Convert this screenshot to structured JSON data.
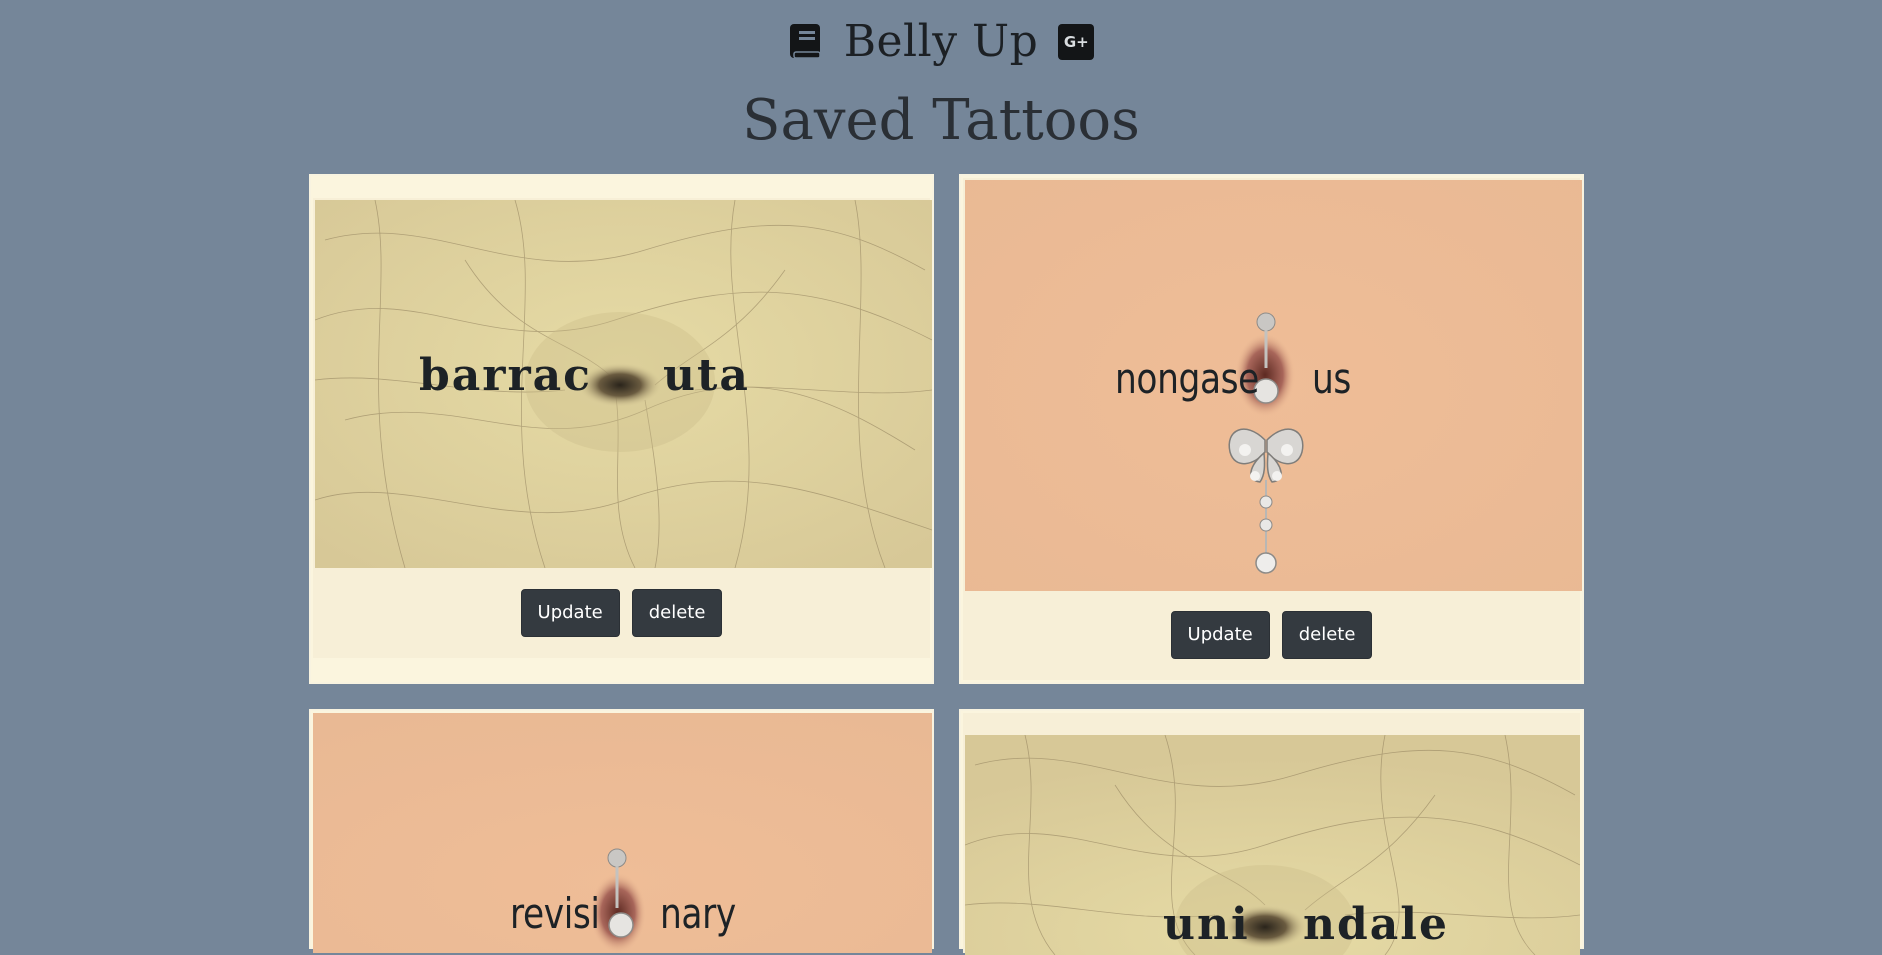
{
  "app": {
    "title": "Belly Up",
    "book_icon": "book-icon",
    "social_icon": "google-plus-icon",
    "social_label": "G+"
  },
  "page": {
    "title": "Saved Tattoos"
  },
  "colors": {
    "background": "#758699",
    "card": "#fbf5de",
    "button": "#343a40"
  },
  "tattoos": [
    {
      "word_left": "barrac",
      "word_right": "uta",
      "belly_style": "hairy",
      "update_label": "Update",
      "delete_label": "delete"
    },
    {
      "word_left": "nongase",
      "word_right": "us",
      "belly_style": "pierced",
      "update_label": "Update",
      "delete_label": "delete"
    },
    {
      "word_left": "revisi",
      "word_right": "nary",
      "belly_style": "pierced"
    },
    {
      "word_left": "uni",
      "word_right": "ndale",
      "belly_style": "hairy"
    }
  ]
}
